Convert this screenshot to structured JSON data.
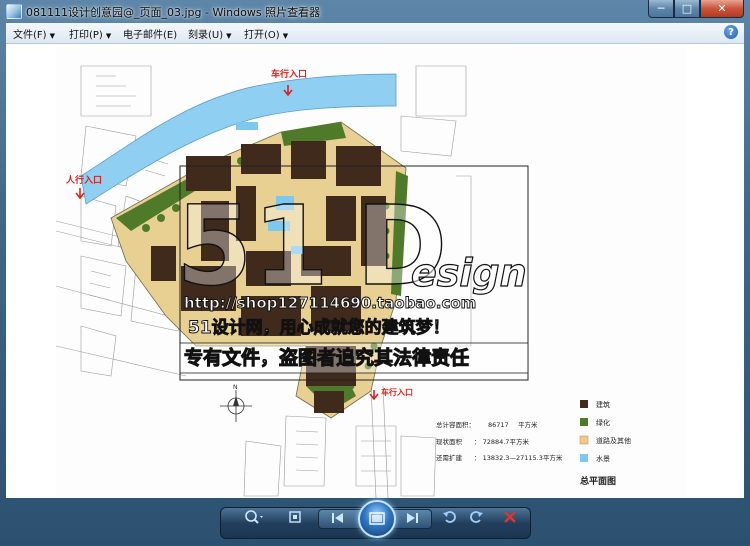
{
  "window": {
    "title": "081111设计创意园@_页面_03.jpg - Windows 照片查看器",
    "minimize_glyph": "─",
    "maximize_glyph": "□",
    "close_glyph": "✕"
  },
  "menu": {
    "items": [
      {
        "label": "文件(F)"
      },
      {
        "label": "打印(P)"
      },
      {
        "label": "电子邮件(E)"
      },
      {
        "label": "刻录(U)"
      },
      {
        "label": "打开(O)"
      }
    ],
    "arrow": "▼",
    "help": "?"
  },
  "plan": {
    "entrance_vehicle_top": "车行入口",
    "entrance_pedestrian": "人行入口",
    "entrance_vehicle_bottom": "车行入口",
    "north_mark": "N",
    "legend": [
      {
        "label": "建筑",
        "color": "#3f2a1c"
      },
      {
        "label": "绿化",
        "color": "#4f7a2a"
      },
      {
        "label": "道路及其他",
        "color": "#f5c97e"
      },
      {
        "label": "水景",
        "color": "#7ec8ee"
      }
    ],
    "stats": [
      {
        "label": "总计容面积：",
        "value": "86717",
        "unit": "平方米"
      },
      {
        "label": "现状面积",
        "value": "：   72884.7平方米",
        "unit": ""
      },
      {
        "label": "还需扩建",
        "value": "：   13832.3—27115.3平方米",
        "unit": ""
      }
    ],
    "caption": "总平面图",
    "colors": {
      "water": "#8fd0f2",
      "building": "#3f2a1c",
      "green": "#4f7a2a",
      "plaza": "#e8cf92",
      "red": "#d9221c"
    }
  },
  "watermark": {
    "brand_num": "51",
    "brand_d": "D",
    "brand_rest": "esign",
    "url": "http://shop127114690.taobao.com",
    "slogan": "51设计网，用心成就您的建筑梦！",
    "warning": "专有文件，盗图者追究其法律责任"
  },
  "toolbar": {
    "zoom_icon": "zoom-icon",
    "fit_icon": "actual-size-icon",
    "prev_icon": "previous-icon",
    "slideshow_icon": "slideshow-icon",
    "next_icon": "next-icon",
    "rotate_ccw_icon": "rotate-counterclockwise-icon",
    "rotate_cw_icon": "rotate-clockwise-icon",
    "delete_icon": "delete-icon"
  }
}
